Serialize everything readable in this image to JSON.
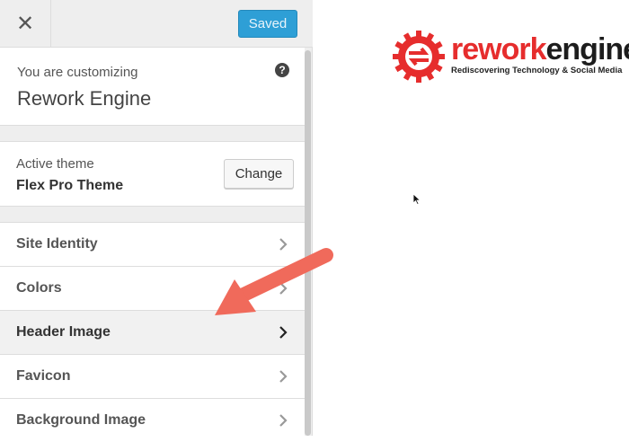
{
  "top_bar": {
    "close_icon": "close-icon",
    "saved_label": "Saved"
  },
  "customizing": {
    "subtitle": "You are customizing",
    "site_title": "Rework Engine",
    "help_symbol": "?"
  },
  "theme": {
    "label": "Active theme",
    "name": "Flex Pro Theme",
    "change_label": "Change"
  },
  "menu": {
    "items": [
      {
        "label": "Site Identity"
      },
      {
        "label": "Colors"
      },
      {
        "label": "Header Image"
      },
      {
        "label": "Favicon"
      },
      {
        "label": "Background Image"
      }
    ]
  },
  "preview": {
    "logo_part1": "rework",
    "logo_part2": "engine",
    "tagline": "Rediscovering Technology & Social Media"
  },
  "colors": {
    "accent": "#2e9fd6",
    "logo_red": "#e62d2d",
    "annotation_arrow": "#f06a5b"
  }
}
